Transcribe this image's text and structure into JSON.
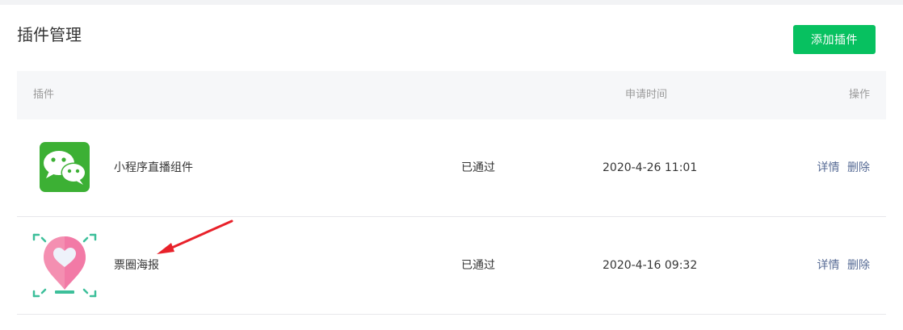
{
  "page": {
    "title": "插件管理"
  },
  "toolbar": {
    "add_label": "添加插件"
  },
  "table": {
    "headers": {
      "plugin": "插件",
      "time": "申请时间",
      "op": "操作"
    },
    "rows": [
      {
        "icon": "wechat-icon",
        "name": "小程序直播组件",
        "status": "已通过",
        "time": "2020-4-26 11:01",
        "detail": "详情",
        "delete": "删除"
      },
      {
        "icon": "location-heart-icon",
        "name": "票圈海报",
        "status": "已通过",
        "time": "2020-4-16 09:32",
        "detail": "详情",
        "delete": "删除"
      }
    ]
  },
  "colors": {
    "accent": "#07c160",
    "link": "#576b95",
    "annotation": "#e8212a"
  }
}
